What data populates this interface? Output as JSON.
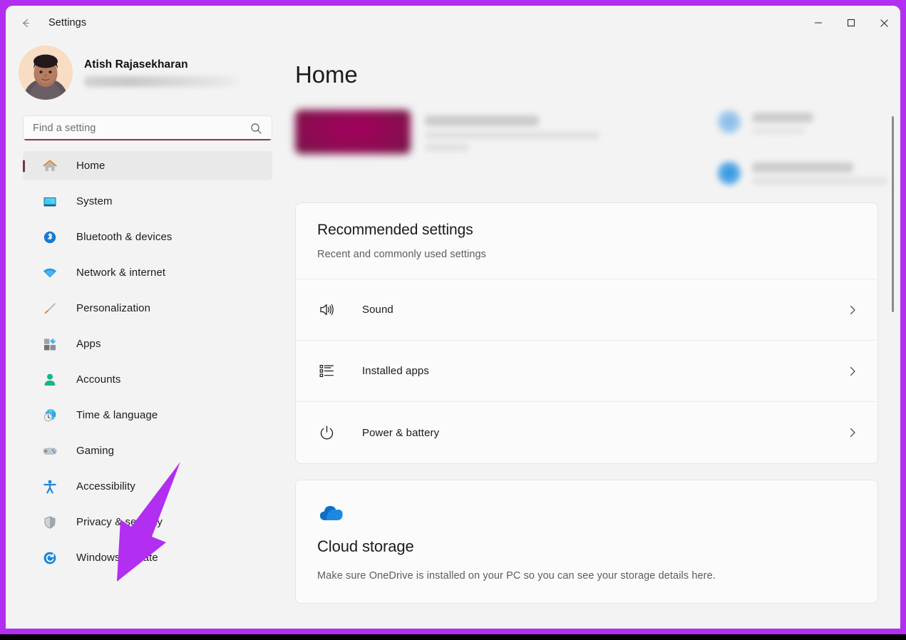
{
  "window": {
    "title": "Settings",
    "back_icon": "back-arrow-icon",
    "controls": {
      "minimize": "minimize-icon",
      "maximize": "maximize-icon",
      "close": "close-icon"
    }
  },
  "account": {
    "name": "Atish Rajasekharan",
    "email_redacted": true,
    "avatar_icon": "user-avatar-photo"
  },
  "search": {
    "placeholder": "Find a setting",
    "value": "",
    "icon": "search-icon",
    "accent_color": "#8a3a55"
  },
  "sidebar": {
    "selected_index": 0,
    "selection_indicator_color": "#77334a",
    "items": [
      {
        "label": "Home",
        "icon": "home-icon"
      },
      {
        "label": "System",
        "icon": "system-monitor-icon"
      },
      {
        "label": "Bluetooth & devices",
        "icon": "bluetooth-icon"
      },
      {
        "label": "Network & internet",
        "icon": "wifi-icon"
      },
      {
        "label": "Personalization",
        "icon": "paintbrush-icon"
      },
      {
        "label": "Apps",
        "icon": "apps-grid-icon"
      },
      {
        "label": "Accounts",
        "icon": "person-icon"
      },
      {
        "label": "Time & language",
        "icon": "clock-globe-icon"
      },
      {
        "label": "Gaming",
        "icon": "gamepad-icon"
      },
      {
        "label": "Accessibility",
        "icon": "accessibility-person-icon"
      },
      {
        "label": "Privacy & security",
        "icon": "shield-icon"
      },
      {
        "label": "Windows Update",
        "icon": "windows-update-sync-icon"
      }
    ]
  },
  "main": {
    "page_title": "Home",
    "recommended": {
      "title": "Recommended settings",
      "subtitle": "Recent and commonly used settings",
      "rows": [
        {
          "label": "Sound",
          "icon": "speaker-volume-icon",
          "chevron": "chevron-right-icon"
        },
        {
          "label": "Installed apps",
          "icon": "list-bullet-icon",
          "chevron": "chevron-right-icon"
        },
        {
          "label": "Power & battery",
          "icon": "power-icon",
          "chevron": "chevron-right-icon"
        }
      ]
    },
    "cloud_storage": {
      "icon": "onedrive-cloud-icon",
      "title": "Cloud storage",
      "description": "Make sure OneDrive is installed on your PC so you can see your storage details here."
    },
    "scrollbar": {
      "visible": true
    }
  },
  "annotation": {
    "arrow_color": "#b22ef0",
    "border_color": "#b22ef0",
    "points_to": "Windows Update"
  }
}
